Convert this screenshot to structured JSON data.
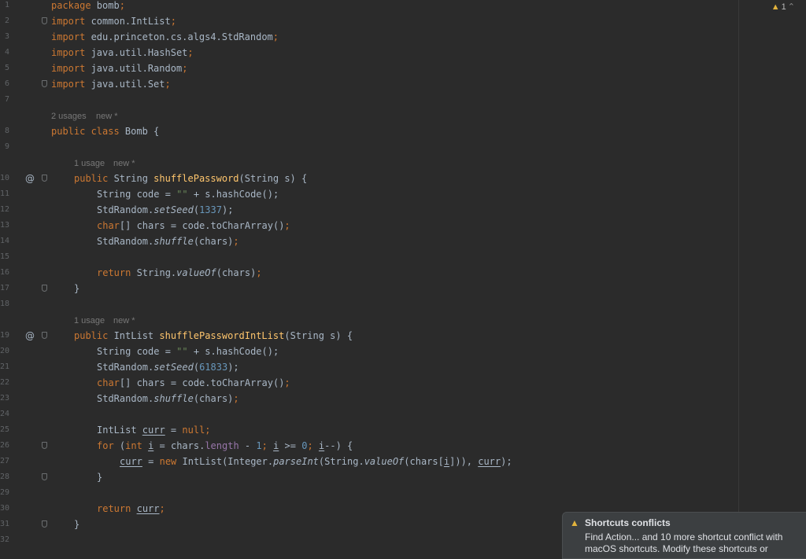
{
  "gutter": {
    "line_numbers": [
      "1",
      "2",
      "3",
      "4",
      "5",
      "6",
      "7",
      "8",
      "9",
      "10",
      "11",
      "12",
      "13",
      "14",
      "15",
      "16",
      "17",
      "18",
      "19",
      "20",
      "21",
      "22",
      "23",
      "24",
      "25",
      "26",
      "27",
      "28",
      "29",
      "30",
      "31",
      "32"
    ],
    "override_marker": "@"
  },
  "inlay_hints": {
    "class_usages": "2 usages",
    "method1_usages": "1 usage",
    "method2_usages": "1 usage",
    "new_label": "new *"
  },
  "code": {
    "l1_kw": "package",
    "l1_rest": " bomb",
    "l2_kw": "import",
    "l2_rest": " common.IntList",
    "l3_kw": "import",
    "l3_rest": " edu.princeton.cs.algs4.StdRandom",
    "l4_kw": "import",
    "l4_rest": " java.util.HashSet",
    "l5_kw": "import",
    "l5_rest": " java.util.Random",
    "l6_kw": "import",
    "l6_rest": " java.util.Set",
    "semicolon": ";",
    "l8_kw": "public class",
    "l8_rest": " Bomb {",
    "l10_kw": "public",
    "l10_type": " String ",
    "l10_fn": "shufflePassword",
    "l10_rest": "(String s) {",
    "code_decl": "String code = ",
    "empty_str": "\"\"",
    "hash_rest": " + s.hashCode();",
    "stdrandom": "StdRandom.",
    "set_seed": "setSeed",
    "paren_open": "(",
    "seed1": "1337",
    "paren_close_semi": ");",
    "char_kw": "char",
    "chars_decl": "[] chars = code.toCharArray()",
    "shuffle": "shuffle",
    "shuffle_arg": "(chars)",
    "return_kw": "return",
    "string_dot": " String.",
    "value_of": "valueOf",
    "return_arg": "(chars)",
    "close_brace": "}",
    "l19_kw": "public",
    "l19_type": " IntList ",
    "l19_fn": "shufflePasswordIntList",
    "l19_rest": "(String s) {",
    "seed2": "61833",
    "intlist_decl": "IntList ",
    "curr": "curr",
    "eq": " = ",
    "null_kw": "null",
    "for_kw": "for",
    "for_open": " (",
    "int_kw": "int",
    "space": " ",
    "i_var": "i",
    "chars_dot": " = chars.",
    "length": "length",
    "minus": " - ",
    "one": "1",
    "cond_mid": " >= ",
    "zero": "0",
    "dec": "--) {",
    "new_kw": "new",
    "intlist_call": " IntList(Integer.",
    "parse_int": "parseInt",
    "pi_arg": "(String.",
    "chars_idx_open": "(chars[",
    "chars_idx_close": "])), ",
    "comma": ","
  },
  "warnings": {
    "count": "1"
  },
  "notification": {
    "title": "Shortcuts conflicts",
    "body": "Find Action... and 10 more shortcut conflict with macOS shortcuts. Modify these shortcuts or"
  }
}
